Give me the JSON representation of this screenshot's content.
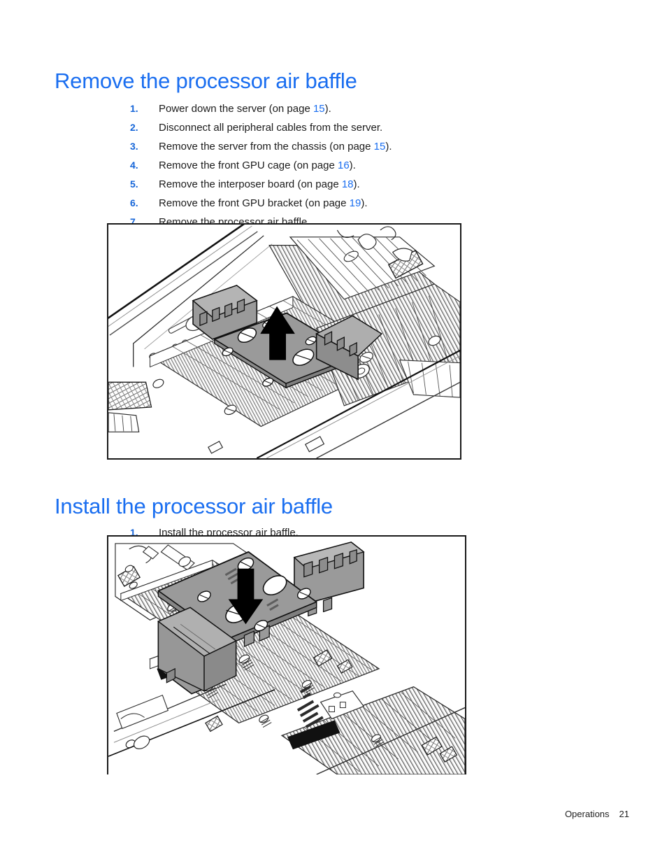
{
  "document": {
    "footer": {
      "section": "Operations",
      "page_number": "21"
    }
  },
  "colors": {
    "heading_blue": "#1a6ef0",
    "list_number_blue": "#1565d8",
    "cross_reference_blue": "#1a6ef0",
    "body_text": "#1b1b1b",
    "figure_border": "#1a1a1a",
    "baffle_gray": "#9a9a9a",
    "arrow_black": "#000000"
  },
  "sections": [
    {
      "id": "remove",
      "heading": "Remove the processor air baffle",
      "steps": [
        {
          "num": "1.",
          "pre": "Power down the server (on page ",
          "ref": "15",
          "post": ")."
        },
        {
          "num": "2.",
          "pre": "Disconnect all peripheral cables from the server.",
          "ref": "",
          "post": ""
        },
        {
          "num": "3.",
          "pre": "Remove the server from the chassis (on page ",
          "ref": "15",
          "post": ")."
        },
        {
          "num": "4.",
          "pre": "Remove the front GPU cage (on page ",
          "ref": "16",
          "post": ")."
        },
        {
          "num": "5.",
          "pre": "Remove the interposer board (on page ",
          "ref": "18",
          "post": ")."
        },
        {
          "num": "6.",
          "pre": "Remove the front GPU bracket (on page ",
          "ref": "19",
          "post": ")."
        },
        {
          "num": "7.",
          "pre": "Remove the processor air baffle.",
          "ref": "",
          "post": ""
        }
      ],
      "figure": {
        "name": "remove-processor-air-baffle-illustration",
        "description": "Line-art drawing of a server chassis interior with processor heatsinks; the gray processor air baffle is lifted straight up, indicated by an upward black arrow.",
        "arrow_direction": "up"
      }
    },
    {
      "id": "install",
      "heading": "Install the processor air baffle",
      "steps": [
        {
          "num": "1.",
          "pre": "Install the processor air baffle.",
          "ref": "",
          "post": ""
        }
      ],
      "figure": {
        "name": "install-processor-air-baffle-illustration",
        "description": "Line-art drawing of the gray processor air baffle positioned above the system board heatsinks, being lowered into place as indicated by a downward black arrow.",
        "arrow_direction": "down"
      }
    }
  ]
}
